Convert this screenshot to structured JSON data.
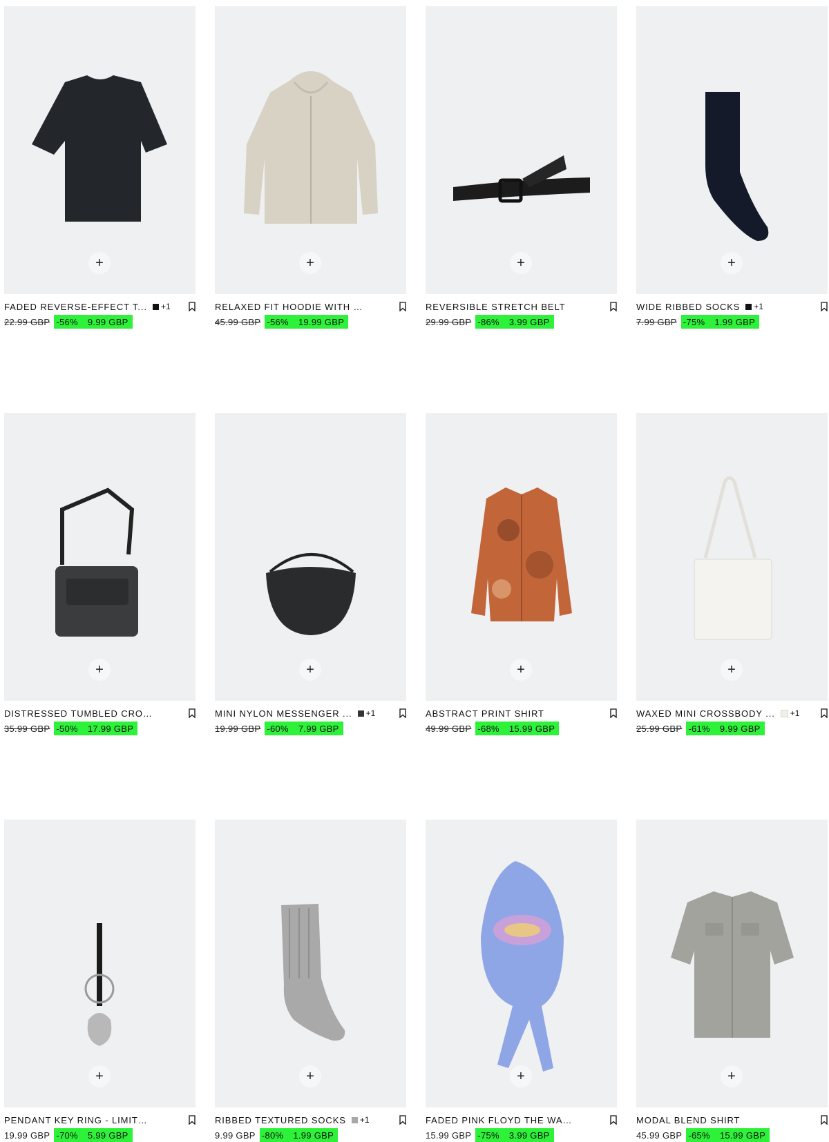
{
  "colors": {
    "sale_highlight": "#2ef23a",
    "image_background": "#eef0f2"
  },
  "products": [
    {
      "name": "FADED REVERSE-EFFECT T...",
      "swatch_color": "#111111",
      "extra_colors": "+1",
      "old_price": "22.99 GBP",
      "discount": "-56%",
      "price": "9.99 GBP",
      "old_struck": true,
      "icon": "tshirt"
    },
    {
      "name": "RELAXED FIT HOODIE WITH ZIP",
      "swatch_color": "",
      "extra_colors": "",
      "old_price": "45.99 GBP",
      "discount": "-56%",
      "price": "19.99 GBP",
      "old_struck": true,
      "icon": "hoodie"
    },
    {
      "name": "REVERSIBLE STRETCH BELT",
      "swatch_color": "",
      "extra_colors": "",
      "old_price": "29.99 GBP",
      "discount": "-86%",
      "price": "3.99 GBP",
      "old_struck": true,
      "icon": "belt"
    },
    {
      "name": "WIDE RIBBED SOCKS",
      "swatch_color": "#111111",
      "extra_colors": "+1",
      "old_price": "7.99 GBP",
      "discount": "-75%",
      "price": "1.99 GBP",
      "old_struck": true,
      "icon": "sock-dark"
    },
    {
      "name": "DISTRESSED TUMBLED CROSSB...",
      "swatch_color": "",
      "extra_colors": "",
      "old_price": "35.99 GBP",
      "discount": "-50%",
      "price": "17.99 GBP",
      "old_struck": true,
      "icon": "crossbody-bag"
    },
    {
      "name": "MINI NYLON MESSENGER ...",
      "swatch_color": "#333333",
      "extra_colors": "+1",
      "old_price": "19.99 GBP",
      "discount": "-60%",
      "price": "7.99 GBP",
      "old_struck": true,
      "icon": "messenger-bag"
    },
    {
      "name": "ABSTRACT PRINT SHIRT",
      "swatch_color": "",
      "extra_colors": "",
      "old_price": "49.99 GBP",
      "discount": "-68%",
      "price": "15.99 GBP",
      "old_struck": true,
      "icon": "print-shirt"
    },
    {
      "name": "WAXED MINI CROSSBODY ...",
      "swatch_color": "#f1efe8",
      "extra_colors": "+1",
      "old_price": "25.99 GBP",
      "discount": "-61%",
      "price": "9.99 GBP",
      "old_struck": true,
      "icon": "white-bag"
    },
    {
      "name": "PENDANT KEY RING - LIMITED E...",
      "swatch_color": "",
      "extra_colors": "",
      "old_price": "19.99 GBP",
      "discount": "-70%",
      "price": "5.99 GBP",
      "old_struck": false,
      "icon": "key-ring"
    },
    {
      "name": "RIBBED TEXTURED SOCKS",
      "swatch_color": "#a8a8a8",
      "extra_colors": "+1",
      "old_price": "9.99 GBP",
      "discount": "-80%",
      "price": "1.99 GBP",
      "old_struck": false,
      "icon": "sock-grey"
    },
    {
      "name": "FADED PINK FLOYD THE WALL ©...",
      "swatch_color": "",
      "extra_colors": "",
      "old_price": "15.99 GBP",
      "discount": "-75%",
      "price": "3.99 GBP",
      "old_struck": false,
      "icon": "bandana"
    },
    {
      "name": "MODAL BLEND SHIRT",
      "swatch_color": "",
      "extra_colors": "",
      "old_price": "45.99 GBP",
      "discount": "-65%",
      "price": "15.99 GBP",
      "old_struck": false,
      "icon": "grey-shirt"
    }
  ],
  "add_button_symbol": "+"
}
